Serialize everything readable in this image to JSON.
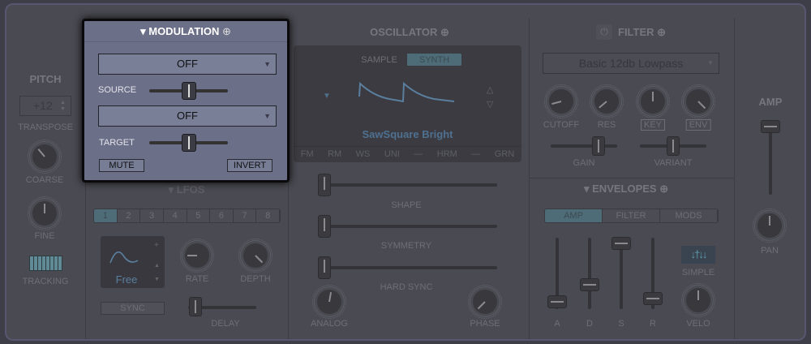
{
  "pitch": {
    "title": "PITCH",
    "transpose_value": "+12",
    "transpose_label": "TRANSPOSE",
    "coarse_label": "COARSE",
    "fine_label": "FINE",
    "tracking_label": "TRACKING"
  },
  "modulation": {
    "title": "MODULATION",
    "source_value": "OFF",
    "source_label": "SOURCE",
    "target_value": "OFF",
    "target_label": "TARGET",
    "mute_label": "MUTE",
    "invert_label": "INVERT",
    "source_amount": 0.5,
    "target_amount": 0.5
  },
  "lfos": {
    "title": "LFOS",
    "tabs": [
      "1",
      "2",
      "3",
      "4",
      "5",
      "6",
      "7",
      "8"
    ],
    "active_tab": "1",
    "mode": "Free",
    "rate_label": "RATE",
    "depth_label": "DEPTH",
    "sync_label": "SYNC",
    "delay_label": "DELAY"
  },
  "oscillator": {
    "title": "OSCILLATOR",
    "modes": [
      "SAMPLE",
      "SYNTH"
    ],
    "active_mode": "SYNTH",
    "preset": "SawSquare Bright",
    "bottom_tabs": [
      "FM",
      "RM",
      "WS",
      "UNI",
      "—",
      "HRM",
      "—",
      "GRN"
    ],
    "shape_label": "SHAPE",
    "symmetry_label": "SYMMETRY",
    "hard_sync_label": "HARD SYNC",
    "analog_label": "ANALOG",
    "phase_label": "PHASE"
  },
  "filter": {
    "title": "FILTER",
    "type": "Basic 12db Lowpass",
    "cutoff_label": "CUTOFF",
    "res_label": "RES",
    "key_label": "KEY",
    "env_label": "ENV",
    "gain_label": "GAIN",
    "variant_label": "VARIANT"
  },
  "envelopes": {
    "title": "ENVELOPES",
    "tabs": [
      "AMP",
      "FILTER",
      "MODS"
    ],
    "active_tab": "AMP",
    "a_label": "A",
    "d_label": "D",
    "s_label": "S",
    "r_label": "R",
    "simple_label": "SIMPLE",
    "velo_label": "VELO"
  },
  "amp": {
    "title": "AMP",
    "pan_label": "PAN"
  },
  "colors": {
    "accent": "#4d6c78",
    "popup_bg": "#6b6f87",
    "waveform": "#5a7f9e"
  }
}
